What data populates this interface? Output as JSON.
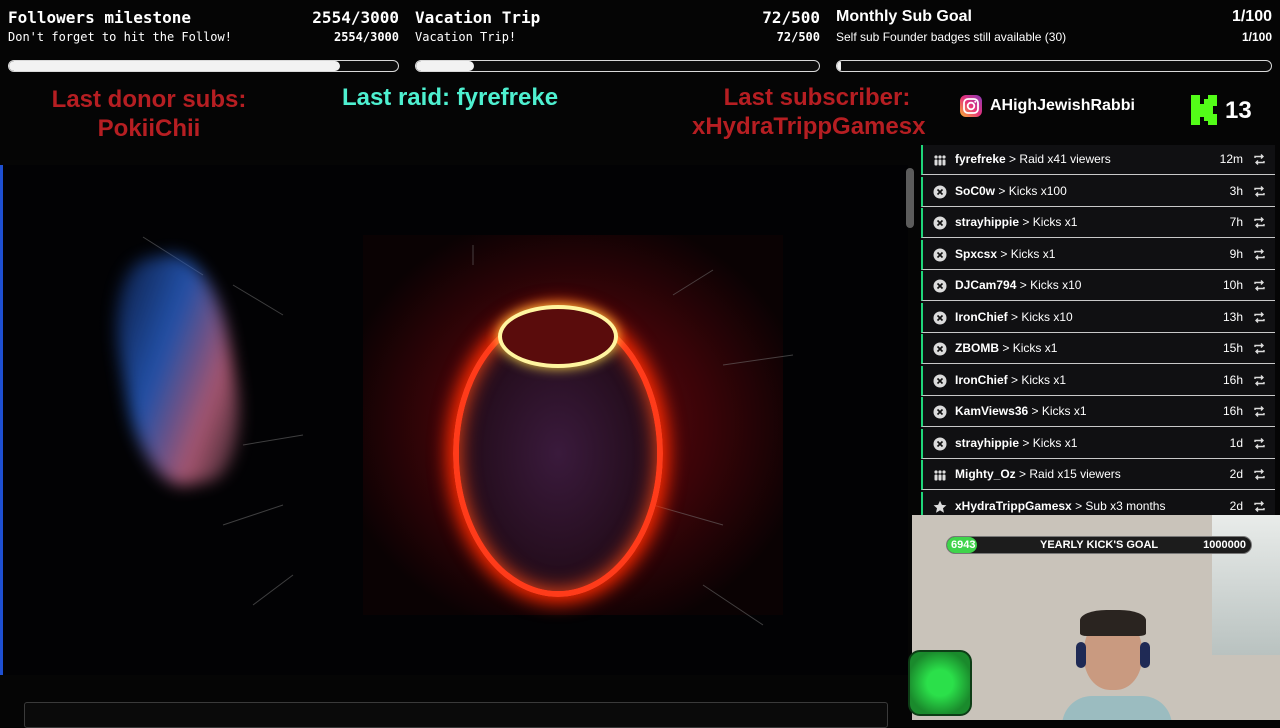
{
  "goals": [
    {
      "title": "Followers milestone",
      "title_value": "2554/3000",
      "subtitle": "Don't forget to hit the Follow!",
      "sub_value": "2554/3000",
      "progress": 0.851
    },
    {
      "title": "Vacation Trip",
      "title_value": "72/500",
      "subtitle": "Vacation Trip!",
      "sub_value": "72/500",
      "progress": 0.144
    },
    {
      "title": "Monthly Sub Goal",
      "title_value": "1/100",
      "subtitle": "Self sub Founder badges still available (30)",
      "sub_value": "1/100",
      "progress": 0.01
    }
  ],
  "alerts": {
    "donor_label": "Last donor subs:",
    "donor_name": "PokiiChii",
    "raid_text": "Last raid: fyrefreke",
    "subscriber_label": "Last subscriber:",
    "subscriber_name": "xHydraTrippGamesx"
  },
  "social": {
    "instagram_handle": "AHighJewishRabbi",
    "kick_count": "13"
  },
  "feed": [
    {
      "icon": "raid-icon",
      "name": "fyrefreke",
      "action": "Raid x41 viewers",
      "time": "12m"
    },
    {
      "icon": "kick-coin-icon",
      "name": "SoC0w",
      "action": "Kicks x100",
      "time": "3h"
    },
    {
      "icon": "kick-coin-icon",
      "name": "strayhippie",
      "action": "Kicks x1",
      "time": "7h"
    },
    {
      "icon": "kick-coin-icon",
      "name": "Spxcsx",
      "action": "Kicks x1",
      "time": "9h"
    },
    {
      "icon": "kick-coin-icon",
      "name": "DJCam794",
      "action": "Kicks x10",
      "time": "10h"
    },
    {
      "icon": "kick-coin-icon",
      "name": "IronChief",
      "action": "Kicks x10",
      "time": "13h"
    },
    {
      "icon": "kick-coin-icon",
      "name": "ZBOMB",
      "action": "Kicks x1",
      "time": "15h"
    },
    {
      "icon": "kick-coin-icon",
      "name": "IronChief",
      "action": "Kicks x1",
      "time": "16h"
    },
    {
      "icon": "kick-coin-icon",
      "name": "KamViews36",
      "action": "Kicks x1",
      "time": "16h"
    },
    {
      "icon": "kick-coin-icon",
      "name": "strayhippie",
      "action": "Kicks x1",
      "time": "1d"
    },
    {
      "icon": "raid-icon",
      "name": "Mighty_Oz",
      "action": "Raid x15 viewers",
      "time": "2d"
    },
    {
      "icon": "star-icon",
      "name": "xHydraTrippGamesx",
      "action": "Sub x3 months",
      "time": "2d"
    }
  ],
  "kick_goal": {
    "current": "6943",
    "label": "YEARLY KICK'S GOAL",
    "target": "1000000",
    "progress": 0.0069
  },
  "colors": {
    "accent_green": "#1fd67a",
    "alert_red": "#b61e22",
    "alert_cyan": "#4ef0d0"
  }
}
